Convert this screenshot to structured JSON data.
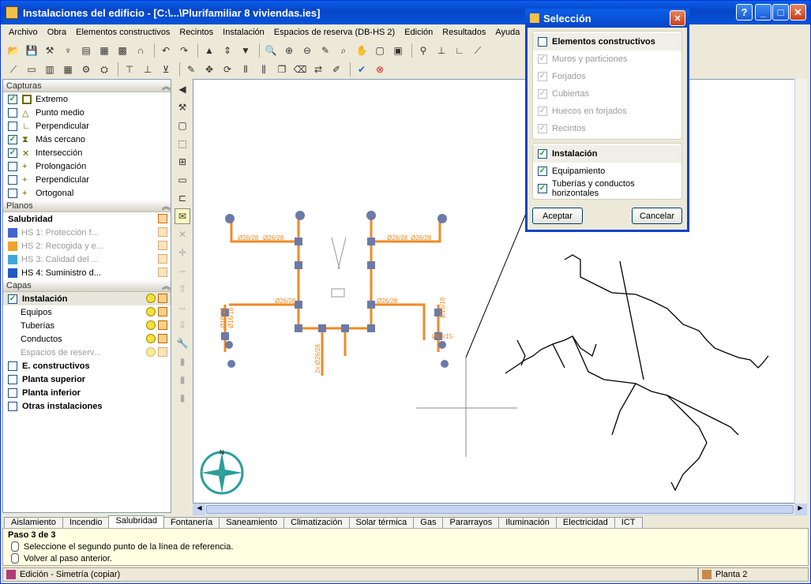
{
  "window": {
    "title": "Instalaciones del edificio - [C:\\...\\Plurifamiliar 8 viviendas.ies]"
  },
  "menu": [
    "Archivo",
    "Obra",
    "Elementos constructivos",
    "Recintos",
    "Instalación",
    "Espacios de reserva (DB-HS 2)",
    "Edición",
    "Resultados",
    "Ayuda"
  ],
  "capturas": {
    "header": "Capturas",
    "items": [
      {
        "label": "Extremo",
        "checked": true
      },
      {
        "label": "Punto medio",
        "checked": false
      },
      {
        "label": "Perpendicular",
        "checked": false
      },
      {
        "label": "Más cercano",
        "checked": true
      },
      {
        "label": "Intersección",
        "checked": true
      },
      {
        "label": "Prolongación",
        "checked": false
      },
      {
        "label": "Perpendicular",
        "checked": false
      },
      {
        "label": "Ortogonal",
        "checked": false
      }
    ]
  },
  "planos": {
    "header": "Planos",
    "group": "Salubridad",
    "items": [
      "HS 1: Protección f...",
      "HS 2: Recogida y e...",
      "HS 3: Calidad del ...",
      "HS 4: Suministro d..."
    ]
  },
  "capas": {
    "header": "Capas",
    "items": [
      {
        "label": "Instalación",
        "checked": true,
        "bold": true
      },
      {
        "label": "Equipos"
      },
      {
        "label": "Tuberías"
      },
      {
        "label": "Conductos"
      },
      {
        "label": "Espacios de reserv..."
      },
      {
        "label": "E. constructivos",
        "checked": false,
        "bold": true
      },
      {
        "label": "Planta superior",
        "checked": false,
        "bold": true
      },
      {
        "label": "Planta inferior",
        "checked": false,
        "bold": true
      },
      {
        "label": "Otras instalaciones",
        "checked": false,
        "bold": true
      }
    ]
  },
  "tabs": [
    "Aislamiento",
    "Incendio",
    "Salubridad",
    "Fontanería",
    "Saneamiento",
    "Climatización",
    "Solar térmica",
    "Gas",
    "Pararrayos",
    "Iluminación",
    "Electricidad",
    "ICT"
  ],
  "active_tab": "Salubridad",
  "steps": {
    "title": "Paso 3 de 3",
    "line1": "Seleccione el segundo punto de la línea de referencia.",
    "line2": "Volver al paso anterior."
  },
  "status": {
    "left": "Edición - Simetría (copiar)",
    "right": "Planta 2"
  },
  "dialog": {
    "title": "Selección",
    "group1": {
      "header": "Elementos constructivos",
      "items": [
        "Muros y particiones",
        "Forjados",
        "Cubiertas",
        "Huecos en forjados",
        "Recintos"
      ]
    },
    "group2": {
      "header": "Instalación",
      "items": [
        "Equipamiento",
        "Tuberías y conductos horizontales"
      ]
    },
    "ok": "Aceptar",
    "cancel": "Cancelar"
  },
  "drawing": {
    "pipe_labels": [
      "Ø26/28",
      "Ø26/28",
      "Ø26/28",
      "Ø26/28",
      "Ø26/28",
      "Ø26/28",
      "2x Ø26/28",
      "Ø16/18",
      "Ø16/18",
      "Ø16/18",
      "Ø13/15"
    ],
    "compass": "N"
  },
  "colors": {
    "pipe": "#f08a24",
    "accent": "#0746c9"
  }
}
